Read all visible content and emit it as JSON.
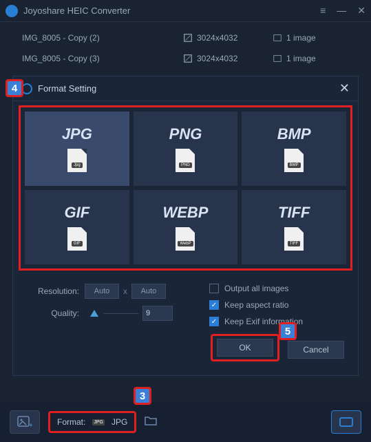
{
  "app": {
    "title": "Joyoshare HEIC Converter"
  },
  "files": [
    {
      "name": "IMG_8005 - Copy (2)",
      "dim": "3024x4032",
      "count": "1 image"
    },
    {
      "name": "IMG_8005 - Copy (3)",
      "dim": "3024x4032",
      "count": "1 image"
    }
  ],
  "dialog": {
    "title": "Format Setting",
    "formats": [
      {
        "label": "JPG",
        "ext": "Jpg",
        "selected": true
      },
      {
        "label": "PNG",
        "ext": "PNG",
        "selected": false
      },
      {
        "label": "BMP",
        "ext": "BMP",
        "selected": false
      },
      {
        "label": "GIF",
        "ext": "GIF",
        "selected": false
      },
      {
        "label": "WEBP",
        "ext": "WebP",
        "selected": false
      },
      {
        "label": "TIFF",
        "ext": "TIFF",
        "selected": false
      }
    ],
    "resolution_label": "Resolution:",
    "res_w": "Auto",
    "res_h": "Auto",
    "quality_label": "Quality:",
    "quality_value": "9",
    "chk_output": "Output all images",
    "chk_aspect": "Keep aspect ratio",
    "chk_exif": "Keep Exif information",
    "ok": "OK",
    "cancel": "Cancel"
  },
  "footer": {
    "format_label": "Format:",
    "format_value": "JPG"
  },
  "callouts": {
    "c3": "3",
    "c4": "4",
    "c5": "5"
  }
}
